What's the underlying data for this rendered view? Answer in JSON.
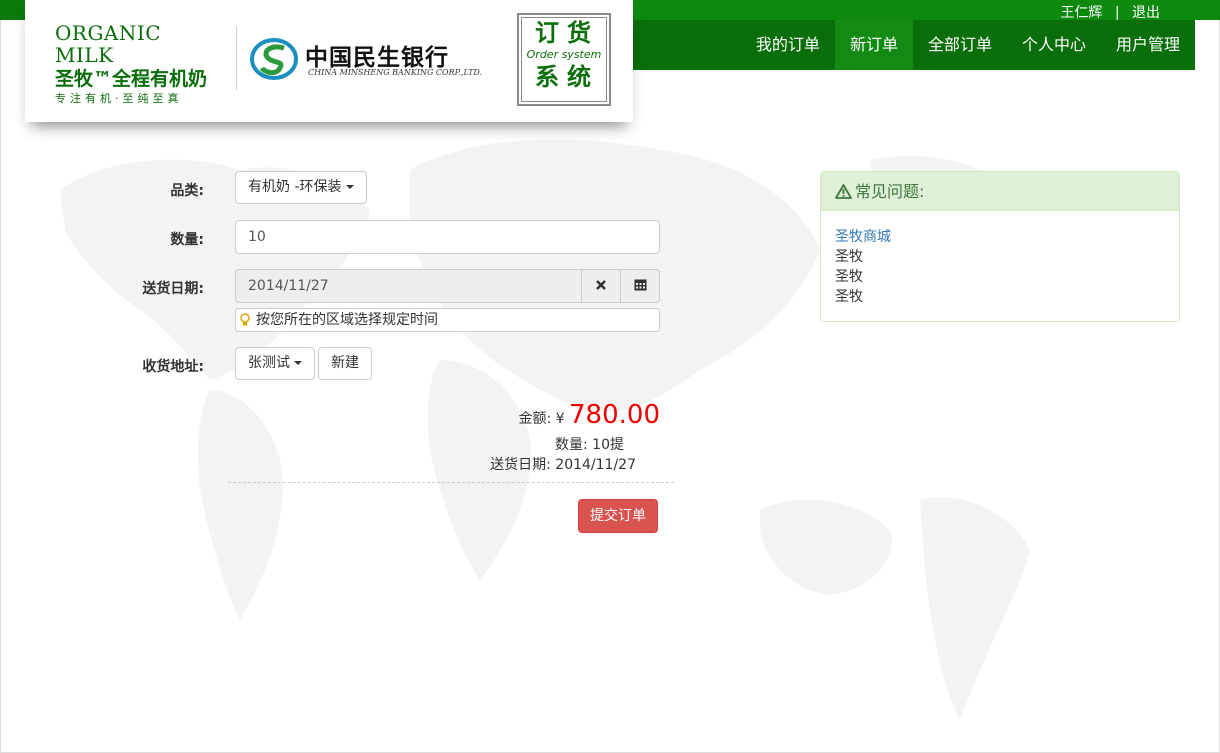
{
  "user": {
    "name": "王仁辉",
    "separator": "|",
    "logout": "退出"
  },
  "nav": {
    "items": [
      {
        "label": "我的订单",
        "active": false
      },
      {
        "label": "新订单",
        "active": true
      },
      {
        "label": "全部订单",
        "active": false
      },
      {
        "label": "个人中心",
        "active": false
      },
      {
        "label": "用户管理",
        "active": false
      }
    ]
  },
  "branding": {
    "organic_en": "ORGANIC MILK",
    "organic_cn": "圣牧™全程有机奶",
    "organic_slogan": "专注有机·至纯至真",
    "bank_cn": "中国民生银行",
    "bank_en": "CHINA MINSHENG BANKING CORP.,LTD.",
    "system_line1": "订货",
    "system_line2": "Order system",
    "system_line3": "系统"
  },
  "form": {
    "category_label": "品类:",
    "category_value": "有机奶 -环保装",
    "quantity_label": "数量:",
    "quantity_value": "10",
    "date_label": "送货日期:",
    "date_value": "2014/11/27",
    "date_hint": "按您所在的区域选择规定时间",
    "address_label": "收货地址:",
    "address_value": "张测试",
    "new_address_button": "新建"
  },
  "summary": {
    "amount_label": "金额:",
    "currency": "¥",
    "amount": "780.00",
    "qty_line": "数量: 10提",
    "date_line": "送货日期: 2014/11/27"
  },
  "submit_label": "提交订单",
  "faq": {
    "title": "常见问题:",
    "items": [
      "圣牧商城",
      "圣牧",
      "圣牧",
      "圣牧"
    ]
  },
  "colors": {
    "brand_green": "#0a6e0a",
    "active_nav": "#138a13",
    "danger": "#d9534f",
    "amount": "#e00000"
  }
}
